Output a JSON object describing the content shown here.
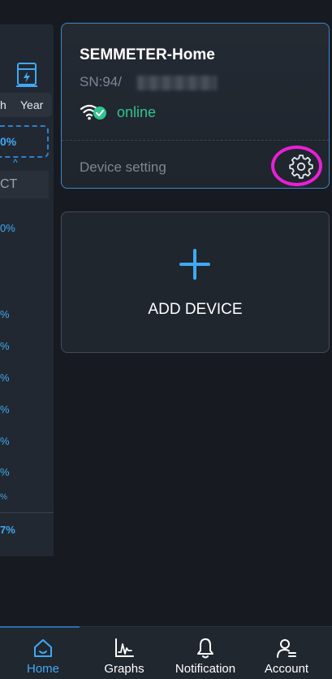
{
  "background_page": {
    "tab_month_partial": "h",
    "tab_year": "Year",
    "highlight_value_partial": "0%",
    "ct_label_partial": "CT",
    "percent_values_partial": [
      "0%",
      "%",
      "%",
      "%",
      "%",
      "%",
      "%",
      "%"
    ],
    "bottom_value_partial": "7%"
  },
  "device_card": {
    "name": "SEMMETER-Home",
    "serial_prefix": "SN:94/",
    "status": "online",
    "setting_label": "Device setting",
    "status_color": "#2fc48f"
  },
  "add_device": {
    "label": "ADD DEVICE",
    "accent_color": "#3fa9f5"
  },
  "bottom_nav": {
    "items": [
      {
        "label": "Home",
        "icon": "home-icon",
        "active": true
      },
      {
        "label": "Graphs",
        "icon": "graph-icon",
        "active": false
      },
      {
        "label": "Notification",
        "icon": "bell-icon",
        "active": false
      },
      {
        "label": "Account",
        "icon": "account-icon",
        "active": false
      }
    ]
  },
  "colors": {
    "accent": "#3fa9f5",
    "online": "#2fc48f",
    "highlight_ring": "#ea1fd6",
    "card_border": "#3f86c8"
  }
}
